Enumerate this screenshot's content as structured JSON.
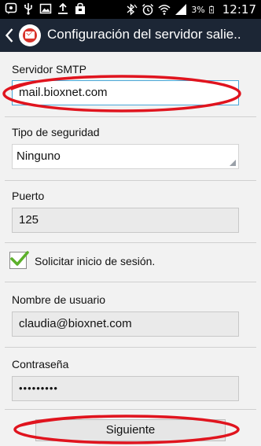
{
  "status_bar": {
    "battery_percent": "3%",
    "time": "12:17"
  },
  "action_bar": {
    "title": "Configuración del servidor salie.."
  },
  "form": {
    "smtp_label": "Servidor SMTP",
    "smtp_value": "mail.bioxnet.com",
    "security_label": "Tipo de seguridad",
    "security_value": "Ninguno",
    "port_label": "Puerto",
    "port_value": "125",
    "signin_label": "Solicitar inicio de sesión.",
    "signin_checked": true,
    "username_label": "Nombre de usuario",
    "username_value": "claudia@bioxnet.com",
    "password_label": "Contraseña",
    "password_value": "•••••••••"
  },
  "footer": {
    "next_label": "Siguiente"
  },
  "colors": {
    "action_bar_bg": "#1c2635",
    "annotation_red": "#e0141e",
    "check_green": "#5cb02a",
    "active_border": "#4aa8d8"
  }
}
